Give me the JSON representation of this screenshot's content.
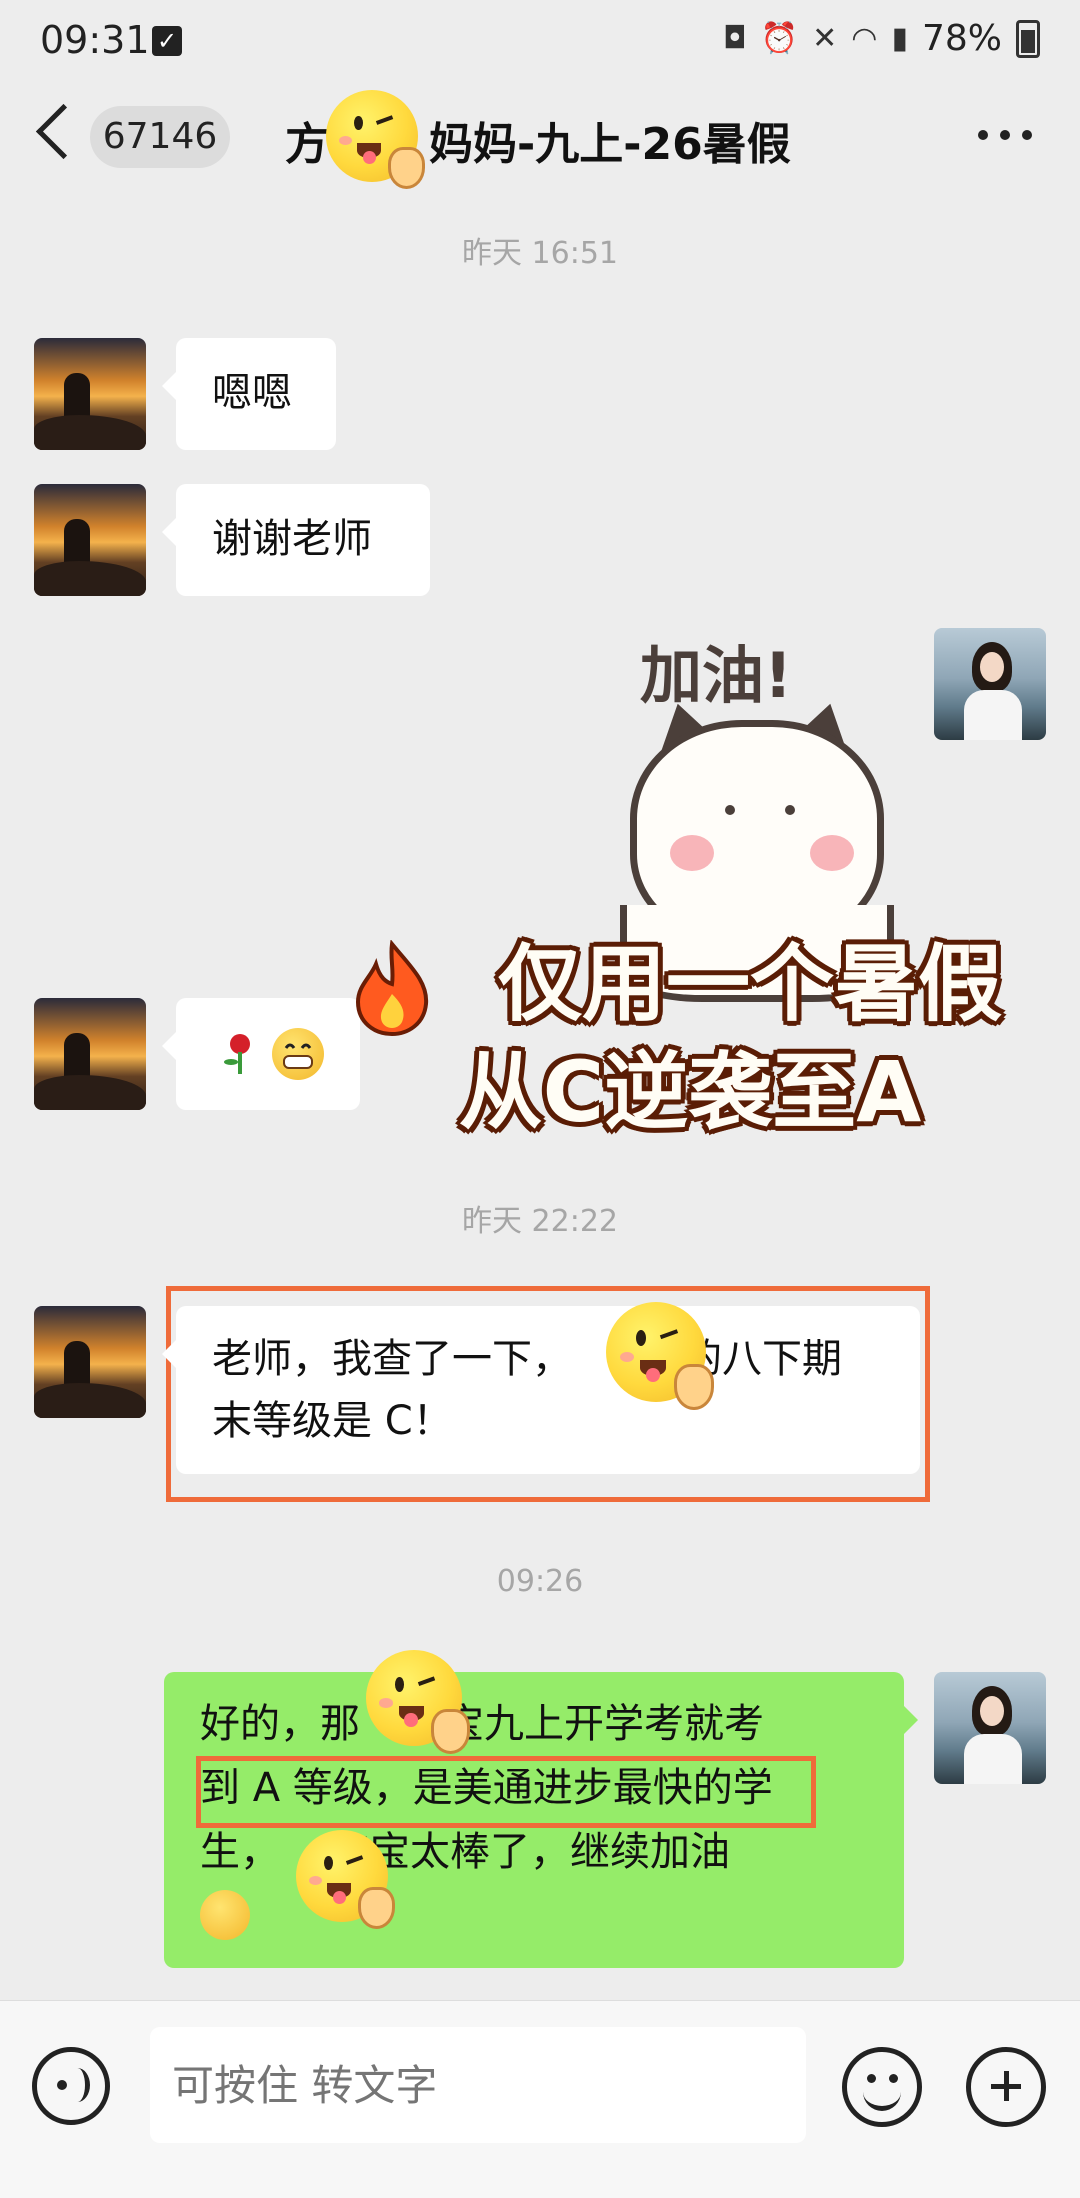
{
  "status_bar": {
    "time": "09:31",
    "battery": "78%",
    "icons": [
      "check-icon",
      "lock-icon",
      "alarm-icon",
      "mute-icon",
      "wifi-icon",
      "signal-icon",
      "battery-icon"
    ]
  },
  "header": {
    "unread_count": "67146",
    "title_prefix": "方",
    "title_suffix": "妈妈-九上-26暑假"
  },
  "messages": [
    {
      "type": "timestamp",
      "text": "昨天 16:51"
    },
    {
      "type": "text",
      "side": "left",
      "text": "嗯嗯"
    },
    {
      "type": "text",
      "side": "left",
      "text": "谢谢老师"
    },
    {
      "type": "sticker",
      "side": "right",
      "sticker_text": "加油!"
    },
    {
      "type": "emoji",
      "side": "left",
      "emojis": [
        "rose-icon",
        "grin-icon"
      ]
    },
    {
      "type": "timestamp",
      "text": "昨天 22:22"
    },
    {
      "type": "text",
      "side": "left",
      "line1_a": "老师，我查了一下，",
      "line1_b": "的八下期",
      "line2": "末等级是 C！"
    },
    {
      "type": "timestamp",
      "text": "09:26"
    },
    {
      "type": "text",
      "side": "right",
      "line1_a": "好的，那",
      "line1_b": "宝宝九上开学考就考",
      "line2": "到 A 等级，是美通进步最快的学",
      "line3_a": "生，",
      "line3_b": "宝宝太棒了，继续加油"
    }
  ],
  "overlay": {
    "promo_line1": "仅用一个暑假",
    "promo_line2": "从C逆袭至A"
  },
  "input_bar": {
    "placeholder": "可按住 转文字"
  },
  "colors": {
    "outgoing_bubble": "#95ec69",
    "highlight": "#ef6b3a",
    "background": "#ededed"
  }
}
